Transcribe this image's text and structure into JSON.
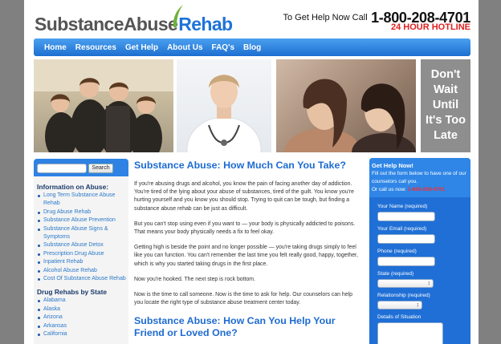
{
  "brand": {
    "word1": "SubstanceAbuse",
    "word2": "Rehab"
  },
  "callout": {
    "prefix": "To Get Help Now Call",
    "phone": "1-800-208-4701",
    "hotline": "24 HOUR HOTLINE"
  },
  "nav": {
    "items": [
      "Home",
      "Resources",
      "Get Help",
      "About Us",
      "FAQ's",
      "Blog"
    ]
  },
  "cta": {
    "lines": [
      "Don't",
      "Wait",
      "Until",
      "It's Too",
      "Late"
    ]
  },
  "search": {
    "button": "Search",
    "value": ""
  },
  "sidebar": {
    "heading1": "Information on Abuse:",
    "info_links": [
      "Long Term Substance Abuse Rehab",
      "Drug Abuse Rehab",
      "Substance Abuse Prevention",
      "Substance Abuse Signs & Symptoms",
      "Substance Abuse Detox",
      "Prescription Drug Abuse",
      "Inpatient Rehab",
      "Alcohol Abuse Rehab",
      "Cost Of Substance Abuse Rehab"
    ],
    "heading2": "Drug Rehabs by State",
    "state_links": [
      "Alabama",
      "Alaska",
      "Arizona",
      "Arkansas",
      "California"
    ]
  },
  "article1": {
    "title": "Substance Abuse: How Much Can You Take?",
    "paragraphs": [
      "If you're abusing drugs and alcohol, you know the pain of facing another day of addiction. You're tired of the lying about your abuse of substances, tired of the guilt. You know you're hurting yourself and you know you should stop. Trying to quit can be tough, but finding a substance abuse rehab can be just as difficult.",
      "But you can't stop using even if you want to — your body is physically addicted to poisons. That means your body physically needs a fix to feel okay.",
      "Getting high is beside the point and no longer possible — you're taking drugs simply to feel like you can function. You can't remember the last time you felt really good, happy, together, which is why you started taking drugs in the first place.",
      "Now you're hooked. The next step is rock bottom.",
      "Now is the time to call someone. Now is the time to ask for help. Our counselors can help you locate the right type of substance abuse treatment center today."
    ]
  },
  "article2": {
    "title": "Substance Abuse: How Can You Help Your Friend or Loved One?"
  },
  "form": {
    "title": "Get Help Now!",
    "desc": "Fill out the form below to have one of our counselors call you.",
    "call_prefix": "Or call us now:",
    "call_phone": "1-800-208-4701",
    "fields": {
      "name": "Your Name (required)",
      "email": "Your Email (required)",
      "phone": "Phone (required)",
      "state": "State (required)",
      "relationship": "Relationship (required)",
      "details": "Details of Situation"
    }
  },
  "colors": {
    "accent": "#1e73d8",
    "nav_top": "#4aa0f0",
    "nav_bottom": "#1d6fd0",
    "hotline": "#e01e1e",
    "cta_bg": "#8e8e8e"
  }
}
